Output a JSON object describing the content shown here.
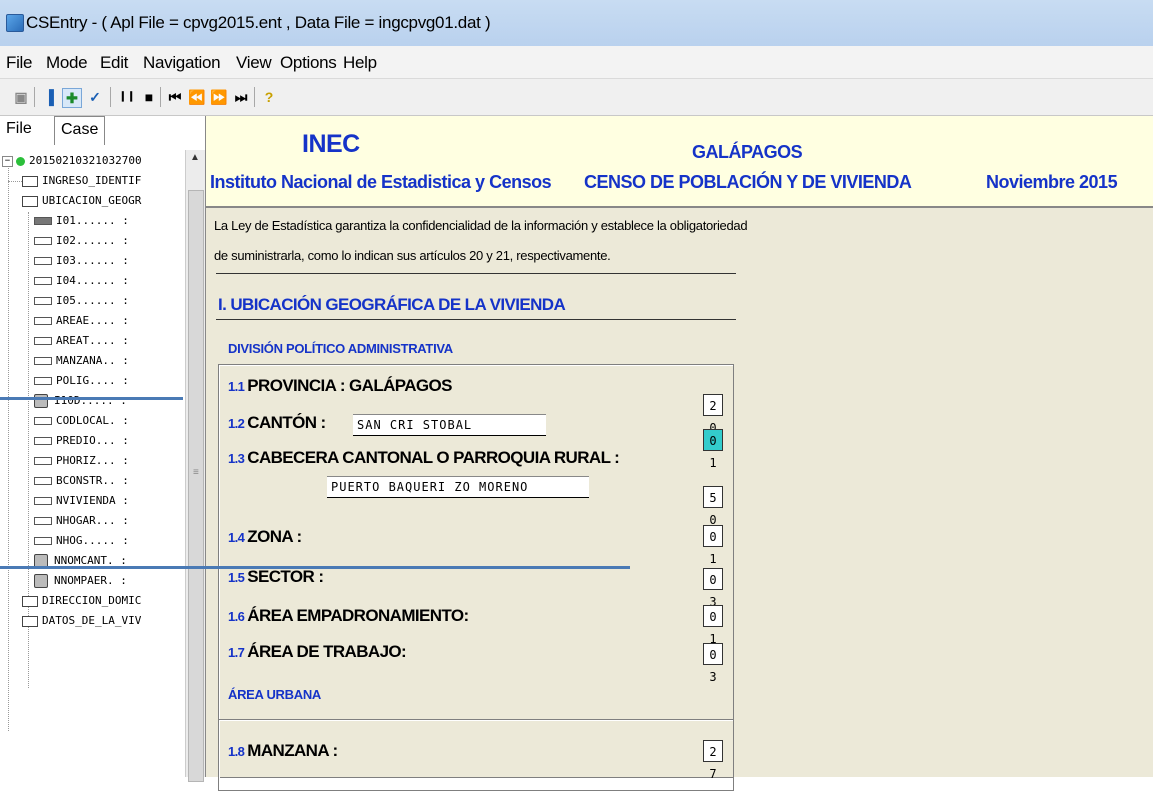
{
  "window": {
    "title": "CSEntry - ( Apl File = cpvg2015.ent , Data File = ingcpvg01.dat )"
  },
  "menu": [
    "File",
    "Mode",
    "Edit",
    "Navigation",
    "View",
    "Options",
    "Help"
  ],
  "toolbar": {
    "icons": [
      "open-icon",
      "add-case-icon",
      "insert-case-icon",
      "modify-case-icon",
      "pause-icon",
      "stop-icon",
      "first-case-icon",
      "previous-case-icon",
      "next-case-icon",
      "last-case-icon",
      "help-icon"
    ],
    "glyphs": [
      "▣",
      "▐",
      "✚",
      "✓",
      "❙❙",
      "■",
      "⏮",
      "⏪",
      "⏩",
      "⏭",
      "?"
    ]
  },
  "sidebar": {
    "tabs": [
      "File",
      "Case"
    ],
    "tree": [
      {
        "label": "20150210321032700",
        "kind": "root"
      },
      {
        "label": "INGRESO_IDENTIF",
        "kind": "folder"
      },
      {
        "label": "UBICACION_GEOGR",
        "kind": "folder"
      },
      {
        "label": "I01...... :",
        "kind": "field-filled"
      },
      {
        "label": "I02...... :",
        "kind": "field"
      },
      {
        "label": "I03...... :",
        "kind": "field"
      },
      {
        "label": "I04...... :",
        "kind": "field"
      },
      {
        "label": "I05...... :",
        "kind": "field"
      },
      {
        "label": "AREAE.... :",
        "kind": "field"
      },
      {
        "label": "AREAT.... :",
        "kind": "field"
      },
      {
        "label": "MANZANA.. :",
        "kind": "field"
      },
      {
        "label": "POLIG.... :",
        "kind": "field"
      },
      {
        "label": "I10D..... :",
        "kind": "lock"
      },
      {
        "label": "CODLOCAL. :",
        "kind": "field"
      },
      {
        "label": "PREDIO... :",
        "kind": "field"
      },
      {
        "label": "PHORIZ... :",
        "kind": "field"
      },
      {
        "label": "BCONSTR.. :",
        "kind": "field"
      },
      {
        "label": "NVIVIENDA :",
        "kind": "field"
      },
      {
        "label": "NHOGAR... :",
        "kind": "field"
      },
      {
        "label": "NHOG..... :",
        "kind": "field"
      },
      {
        "label": "NNOMCANT. :",
        "kind": "lock"
      },
      {
        "label": "NNOMPAER. :",
        "kind": "lock"
      },
      {
        "label": "DIRECCION_DOMIC",
        "kind": "folder"
      },
      {
        "label": "DATOS_DE_LA_VIV",
        "kind": "folder"
      }
    ]
  },
  "header": {
    "org_short": "INEC",
    "org_full": "Instituto Nacional de Estadistica y Censos",
    "region": "GALÁPAGOS",
    "census": "CENSO DE POBLACIÓN Y DE VIVIENDA",
    "date": "Noviembre  2015"
  },
  "form": {
    "legal_line1": "La Ley de Estadística garantiza la confidencialidad de la información y establece la obligatoriedad",
    "legal_line2": "de suministrarla, como lo indican sus artículos 20 y 21, respectivamente.",
    "section_title": "I. UBICACIÓN GEOGRÁFICA DE LA VIVIENDA",
    "dpa_title": "DIVISIÓN POLÍTICO ADMINISTRATIVA",
    "urban_title": "ÁREA URBANA",
    "questions": [
      {
        "num": "1.1",
        "label": "PROVINCIA : GALÁPAGOS",
        "value": "2 0",
        "highlight": false
      },
      {
        "num": "1.2",
        "label": "CANTÓN :",
        "value": "0 1",
        "highlight": true,
        "text": "SAN CRI STOBAL"
      },
      {
        "num": "1.3",
        "label": "CABECERA CANTONAL O  PARROQUIA RURAL :",
        "value": "5 0",
        "highlight": false,
        "text": "PUERTO BAQUERI ZO MORENO"
      },
      {
        "num": "1.4",
        "label": "ZONA :",
        "value": "0 1",
        "highlight": false
      },
      {
        "num": "1.5",
        "label": "SECTOR :",
        "value": "0 3",
        "highlight": false
      },
      {
        "num": "1.6",
        "label": "ÁREA EMPADRONAMIENTO:",
        "value": "0 1",
        "highlight": false
      },
      {
        "num": "1.7",
        "label": "ÁREA DE TRABAJO:",
        "value": "0 3",
        "highlight": false
      },
      {
        "num": "1.8",
        "label": "MANZANA :",
        "value": "2 7",
        "highlight": false
      }
    ]
  }
}
